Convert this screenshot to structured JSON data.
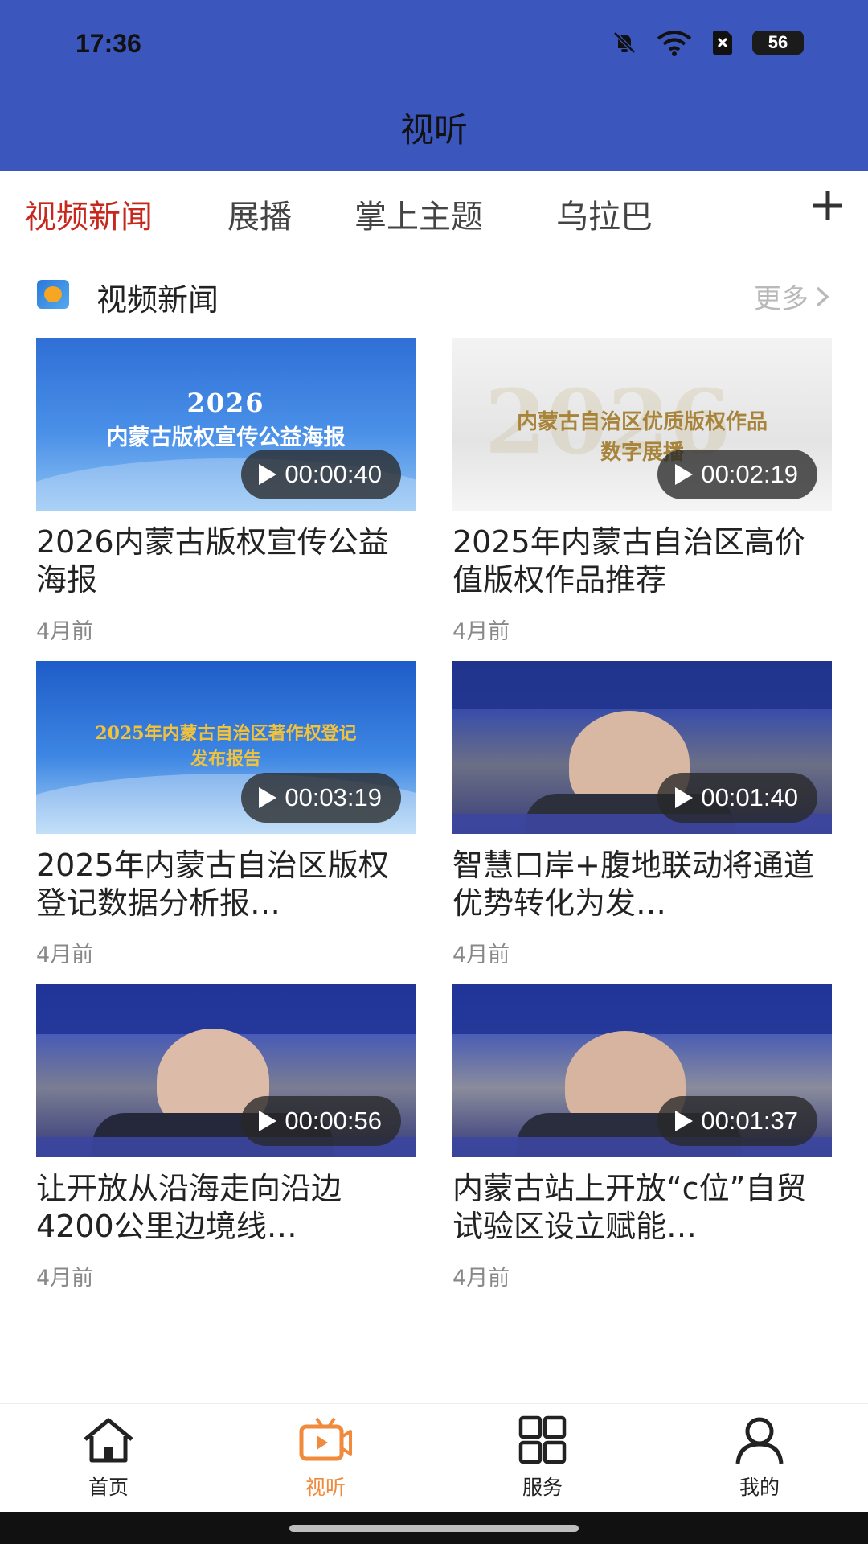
{
  "status_bar": {
    "time": "17:36",
    "battery": "56"
  },
  "header": {
    "title": "视听"
  },
  "tabs": [
    {
      "label": "视频新闻",
      "active": true
    },
    {
      "label": "展播"
    },
    {
      "label": "掌上主题"
    },
    {
      "label": "乌拉巴"
    }
  ],
  "section": {
    "title": "视频新闻",
    "more": "更多"
  },
  "cards": [
    {
      "thumb_line1": "2026",
      "thumb_line2": "内蒙古版权宣传公益海报",
      "duration": "00:00:40",
      "title": "2026内蒙古版权宣传公益海报",
      "date": "4月前"
    },
    {
      "thumb_line1": "内蒙古自治区优质版权作品",
      "thumb_line2": "数字展播",
      "duration": "00:02:19",
      "title": "2025年内蒙古自治区高价值版权作品推荐",
      "date": "4月前"
    },
    {
      "thumb_line1": "2025年内蒙古自治区著作权登记",
      "thumb_line2": "发布报告",
      "duration": "00:03:19",
      "title": "2025年内蒙古自治区版权登记数据分析报…",
      "date": "4月前"
    },
    {
      "duration": "00:01:40",
      "title": "智慧口岸+腹地联动将通道优势转化为发…",
      "date": "4月前"
    },
    {
      "duration": "00:00:56",
      "title": "让开放从沿海走向沿边 4200公里边境线…",
      "date": "4月前"
    },
    {
      "duration": "00:01:37",
      "title": "内蒙古站上开放“c位”自贸试验区设立赋能…",
      "date": "4月前"
    }
  ],
  "bottom_nav": [
    {
      "label": "首页",
      "icon": "home-icon"
    },
    {
      "label": "视听",
      "icon": "video-tv-icon",
      "active": true
    },
    {
      "label": "服务",
      "icon": "grid-icon"
    },
    {
      "label": "我的",
      "icon": "user-icon"
    }
  ],
  "colors": {
    "header_bg": "#3b57bd",
    "active_tab": "#c7281d",
    "active_nav": "#f08a3c"
  }
}
